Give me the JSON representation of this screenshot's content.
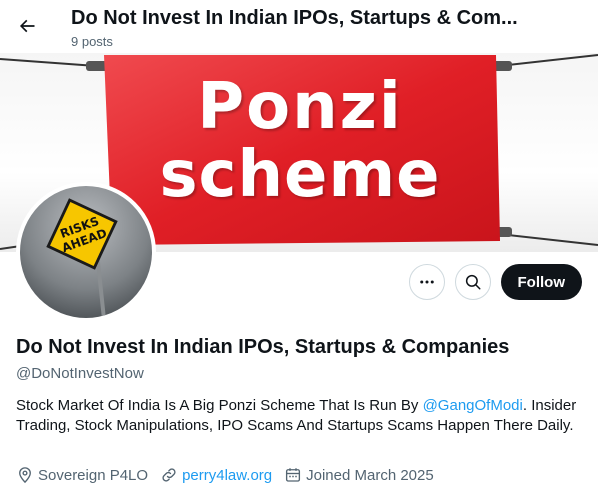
{
  "header": {
    "title": "Do Not Invest In Indian IPOs, Startups & Com...",
    "posts_count": "9 posts",
    "back_icon": "arrow-left-icon"
  },
  "banner": {
    "line1": "Ponzi",
    "line2": "scheme",
    "sign_color": "#e8232a"
  },
  "avatar": {
    "sign_line1": "RISKS",
    "sign_line2": "AHEAD",
    "sign_color": "#f7c600"
  },
  "actions": {
    "more_icon": "more-horizontal-icon",
    "search_icon": "search-icon",
    "follow_label": "Follow"
  },
  "profile": {
    "name": "Do Not Invest In Indian IPOs, Startups & Companies",
    "handle": "@DoNotInvestNow",
    "bio_part1": "Stock Market Of India Is A Big Ponzi Scheme That Is Run By ",
    "bio_mention": "@GangOfModi",
    "bio_part2": ". Insider Trading, Stock Manipulations, IPO Scams And Startups Scams Happen There Daily.",
    "location": "Sovereign P4LO",
    "website": "perry4law.org",
    "joined": "Joined March 2025"
  },
  "colors": {
    "accent": "#1d9bf0",
    "text_primary": "#0f1419",
    "text_secondary": "#536471",
    "follow_bg": "#0f1419"
  }
}
